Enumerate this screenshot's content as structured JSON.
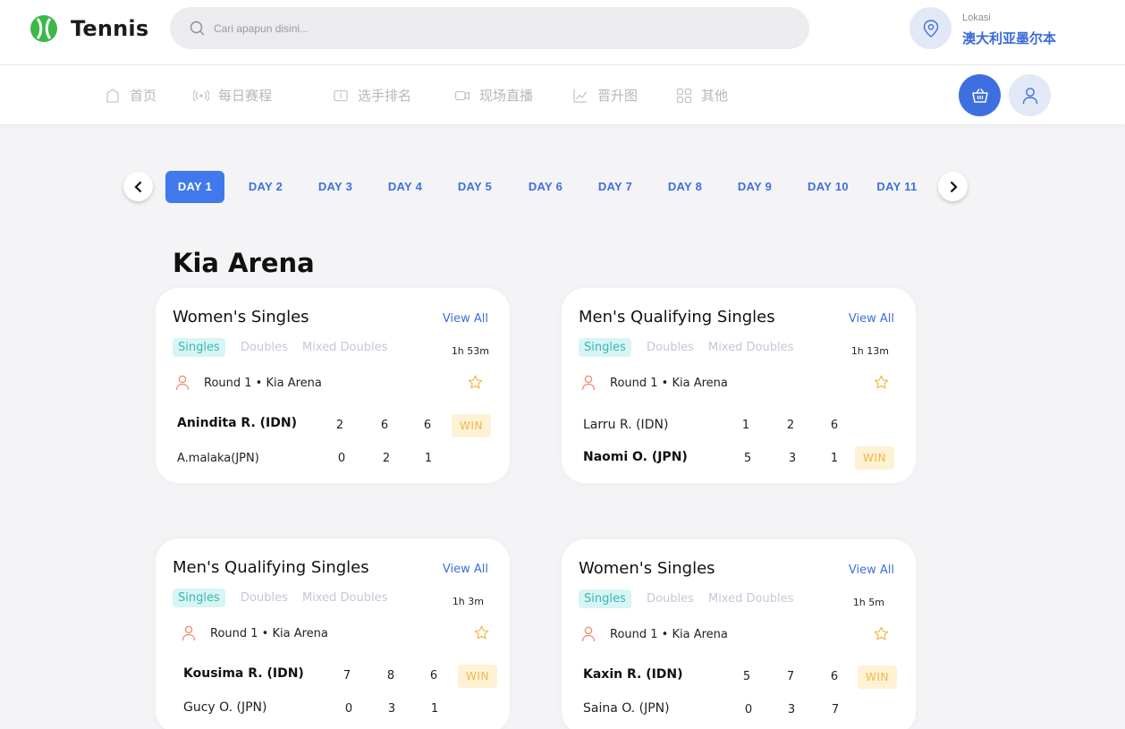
{
  "brand": {
    "name": "Tennis"
  },
  "search": {
    "placeholder": "Cari apapun disini..."
  },
  "location": {
    "caption": "Lokasi",
    "value": "澳大利亚墨尔本"
  },
  "nav": {
    "items": [
      {
        "label": "首页",
        "icon": "home-icon"
      },
      {
        "label": "每日赛程",
        "icon": "broadcast-icon"
      },
      {
        "label": "选手排名",
        "icon": "scoreboard-icon"
      },
      {
        "label": "现场直播",
        "icon": "video-icon"
      },
      {
        "label": "晋升图",
        "icon": "chart-icon"
      },
      {
        "label": "其他",
        "icon": "grid-icon"
      }
    ]
  },
  "days": {
    "selected": "DAY 1",
    "items": [
      "DAY 1",
      "DAY 2",
      "DAY 3",
      "DAY 4",
      "DAY 5",
      "DAY 6",
      "DAY 7",
      "DAY 8",
      "DAY 9",
      "DAY 10",
      "DAY 11"
    ]
  },
  "section": {
    "title": "Kia Arena"
  },
  "cards": [
    {
      "title": "Women's Singles",
      "view_all": "View All",
      "filters": [
        "Singles",
        "Doubles",
        "Mixed Doubles"
      ],
      "active_filter": "Singles",
      "duration": "1h 53m",
      "round": "Round 1 • Kia Arena",
      "players": [
        {
          "name": "Anindita R. (IDN)",
          "scores": [
            "2",
            "6",
            "6"
          ],
          "result": "WIN"
        },
        {
          "name": "A.malaka(JPN)",
          "scores": [
            "0",
            "2",
            "1"
          ],
          "result": ""
        }
      ]
    },
    {
      "title": "Men's Qualifying Singles",
      "view_all": "View All",
      "filters": [
        "Singles",
        "Doubles",
        "Mixed Doubles"
      ],
      "active_filter": "Singles",
      "duration": "1h 13m",
      "round": "Round 1 • Kia Arena",
      "players": [
        {
          "name": "Larru R. (IDN)",
          "scores": [
            "1",
            "2",
            "6"
          ],
          "result": ""
        },
        {
          "name": "Naomi O. (JPN)",
          "scores": [
            "5",
            "3",
            "1"
          ],
          "result": "WIN"
        }
      ]
    },
    {
      "title": "Men's Qualifying Singles",
      "view_all": "View All",
      "filters": [
        "Singles",
        "Doubles",
        "Mixed Doubles"
      ],
      "active_filter": "Singles",
      "duration": "1h 3m",
      "round": "Round 1 • Kia Arena",
      "players": [
        {
          "name": "Kousima R. (IDN)",
          "scores": [
            "7",
            "8",
            "6"
          ],
          "result": "WIN"
        },
        {
          "name": "Gucy O. (JPN)",
          "scores": [
            "0",
            "3",
            "1"
          ],
          "result": ""
        }
      ]
    },
    {
      "title": "Women's Singles",
      "view_all": "View All",
      "filters": [
        "Singles",
        "Doubles",
        "Mixed Doubles"
      ],
      "active_filter": "Singles",
      "duration": "1h 5m",
      "round": "Round 1 • Kia Arena",
      "players": [
        {
          "name": "Kaxin R. (IDN)",
          "scores": [
            "5",
            "7",
            "6"
          ],
          "result": "WIN"
        },
        {
          "name": "Saina O. (JPN)",
          "scores": [
            "0",
            "3",
            "7"
          ],
          "result": ""
        }
      ]
    }
  ],
  "colors": {
    "accent": "#3e6fe0",
    "win_bg": "#fdf2d4",
    "win_text": "#f3b64a",
    "filter_active_bg": "#d6f5f4",
    "brand_green": "#3cb84a"
  }
}
